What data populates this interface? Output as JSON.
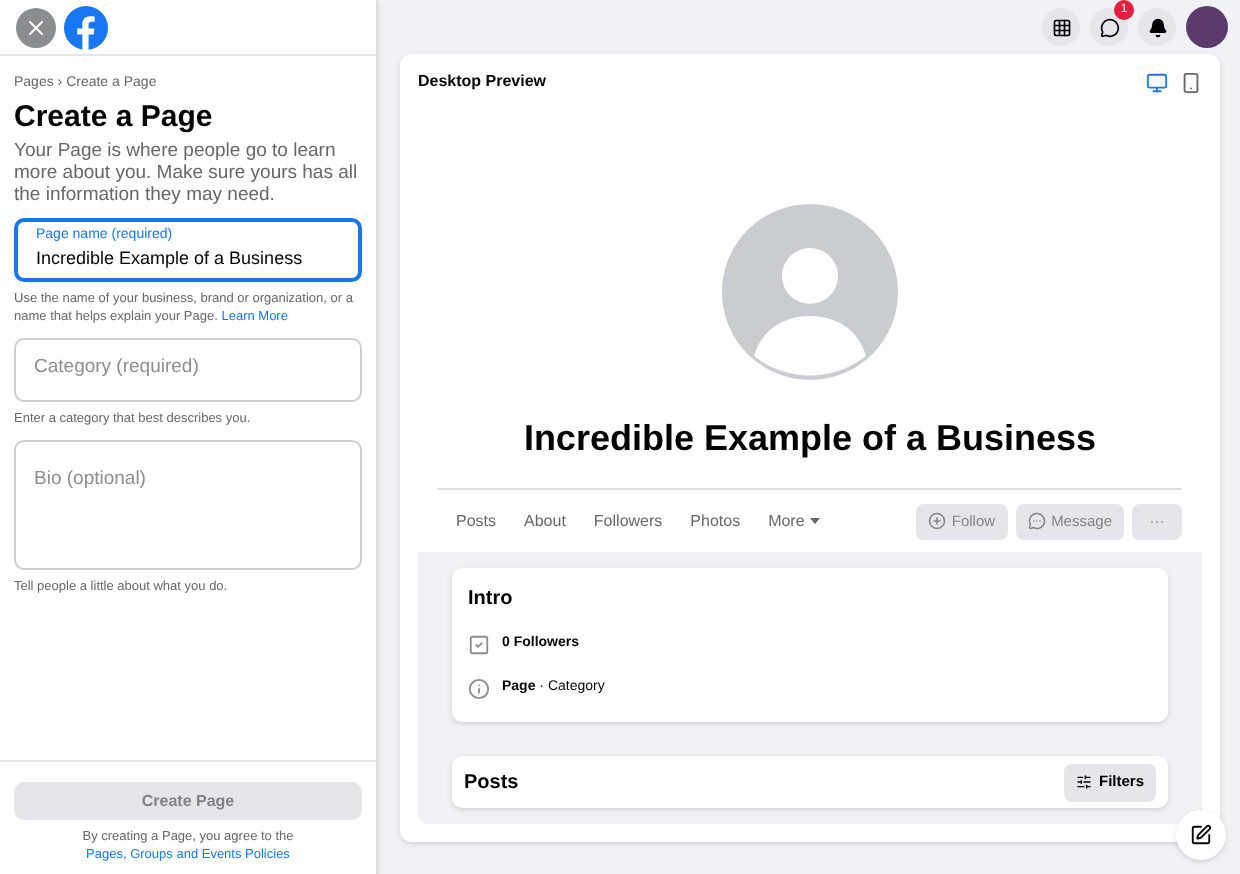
{
  "breadcrumb": "Pages › Create a Page",
  "title": "Create a Page",
  "description": "Your Page is where people go to learn more about you. Make sure yours has all the information they may need.",
  "fields": [
    {
      "kind": "input",
      "label": "Page name (required)",
      "value": "Incredible Example of a Business",
      "focused": true,
      "helper": "Use the name of your business, brand or organization, or a name that helps explain your Page.",
      "helper_link": "Learn More"
    },
    {
      "kind": "input",
      "placeholder": "Category (required)",
      "focused": false,
      "helper": "Enter a category that best describes you."
    },
    {
      "kind": "textarea",
      "placeholder": "Bio (optional)",
      "focused": false,
      "helper": "Tell people a little about what you do."
    }
  ],
  "footer": {
    "button": {
      "label": "Create Page",
      "disabled": true
    },
    "terms_text": "By creating a Page, you agree to the",
    "terms_link": "Pages, Groups and Events Policies"
  },
  "topbar": {
    "messenger_badge": "1"
  },
  "preview": {
    "title": "Desktop Preview",
    "devices": [
      {
        "kind": "desktop",
        "selected": true
      },
      {
        "kind": "mobile",
        "selected": false
      }
    ],
    "page_name": "Incredible Example of a Business",
    "tabs": [
      {
        "label": "Posts",
        "dropdown": false
      },
      {
        "label": "About",
        "dropdown": false
      },
      {
        "label": "Followers",
        "dropdown": false
      },
      {
        "label": "Photos",
        "dropdown": false
      },
      {
        "label": "More",
        "dropdown": true
      }
    ],
    "actions": [
      {
        "kind": "follow",
        "label": "Follow",
        "disabled": true
      },
      {
        "kind": "message",
        "label": "Message",
        "disabled": true
      },
      {
        "kind": "more",
        "label": "···",
        "disabled": true
      }
    ],
    "intro": {
      "title": "Intro",
      "items": [
        {
          "kind": "followers",
          "text": "**0 Followers**"
        },
        {
          "kind": "info",
          "text": "**Page** · Category"
        }
      ]
    },
    "posts": {
      "title": "Posts",
      "filter_button": "Filters"
    }
  }
}
